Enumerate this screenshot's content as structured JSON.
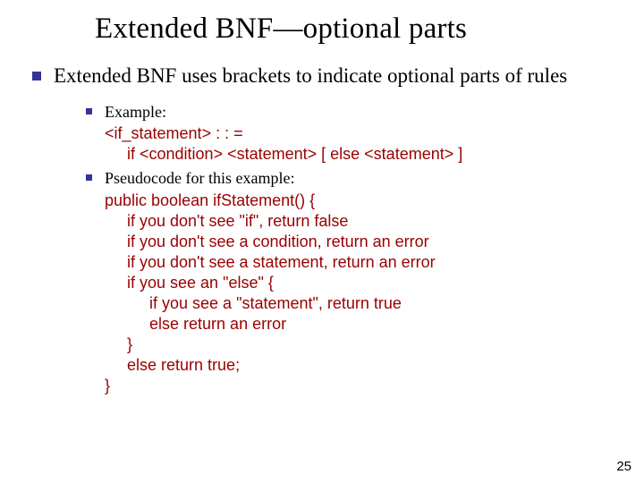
{
  "title": "Extended BNF—optional parts",
  "point1": "Extended BNF uses brackets to indicate optional parts of rules",
  "example_label": "Example:",
  "example_code": "<if_statement> : : =\n     if <condition> <statement> [ else <statement> ]",
  "pseudo_label": "Pseudocode for this example:",
  "pseudo_code": "public boolean ifStatement() {\n     if you don't see \"if\", return false\n     if you don't see a condition, return an error\n     if you don't see a statement, return an error\n     if you see an \"else\" {\n          if you see a \"statement\", return true\n          else return an error\n     }\n     else return true;\n}",
  "page_number": "25"
}
